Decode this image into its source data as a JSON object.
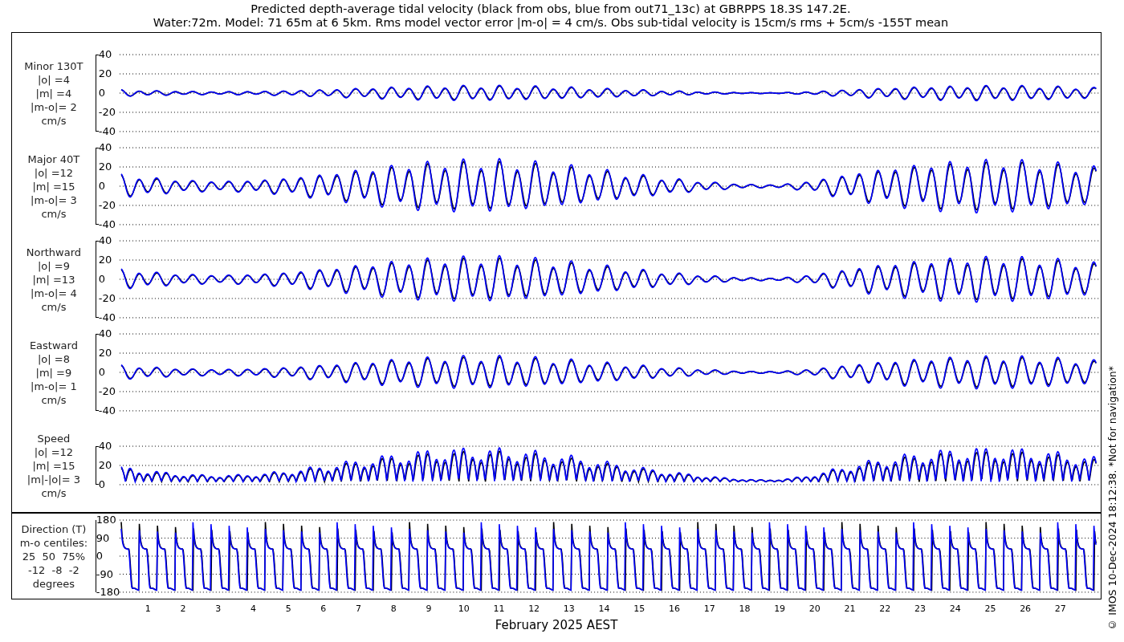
{
  "title_lines": [
    "Predicted depth-average tidal velocity (black from obs, blue from out71_13c) at GBRPPS 18.3S 147.2E.",
    "Water:72m. Model: 71 65m at 6 5km. Rms model vector error |m-o| = 4 cm/s. Obs sub-tidal velocity is 15cm/s rms + 5cm/s -155T mean"
  ],
  "panels": [
    {
      "kind": "minor",
      "label_lines": [
        "Minor 130T",
        "|o| =4",
        "|m| =4",
        "|m-o|= 2",
        "cm/s"
      ],
      "ticks": [
        "40",
        "20",
        "0",
        "-20",
        "-40"
      ]
    },
    {
      "kind": "major",
      "label_lines": [
        "Major 40T",
        "|o| =12",
        "|m| =15",
        "|m-o|= 3",
        "cm/s"
      ],
      "ticks": [
        "40",
        "20",
        "0",
        "-20",
        "-40"
      ]
    },
    {
      "kind": "northward",
      "label_lines": [
        "Northward",
        "|o| =9",
        "|m| =13",
        "|m-o|= 4",
        "cm/s"
      ],
      "ticks": [
        "40",
        "20",
        "0",
        "-20",
        "-40"
      ]
    },
    {
      "kind": "eastward",
      "label_lines": [
        "Eastward",
        "|o| =8",
        "|m| =9",
        "|m-o|= 1",
        "cm/s"
      ],
      "ticks": [
        "40",
        "20",
        "0",
        "-20",
        "-40"
      ]
    },
    {
      "kind": "speed",
      "label_lines": [
        "Speed",
        "|o| =12",
        "|m| =15",
        "|m|-|o|= 3",
        "cm/s"
      ],
      "ticks": [
        "40",
        "20",
        "0"
      ]
    }
  ],
  "direction_panel": {
    "kind": "direction",
    "label_lines": [
      "Direction (T)",
      "m-o centiles:",
      "25  50  75%",
      "-12  -8  -2",
      "degrees"
    ],
    "ticks": [
      "180",
      "90",
      "0",
      "-90",
      "-180"
    ]
  },
  "x_axis": {
    "days": [
      "1",
      "2",
      "3",
      "4",
      "5",
      "6",
      "7",
      "8",
      "9",
      "10",
      "11",
      "12",
      "13",
      "14",
      "15",
      "16",
      "17",
      "18",
      "19",
      "20",
      "21",
      "22",
      "23",
      "24",
      "25",
      "26",
      "27"
    ],
    "label": "February 2025 AEST"
  },
  "side_note": "© IMOS 10-Dec-2024 18:12:38. *Not for navigation*"
}
